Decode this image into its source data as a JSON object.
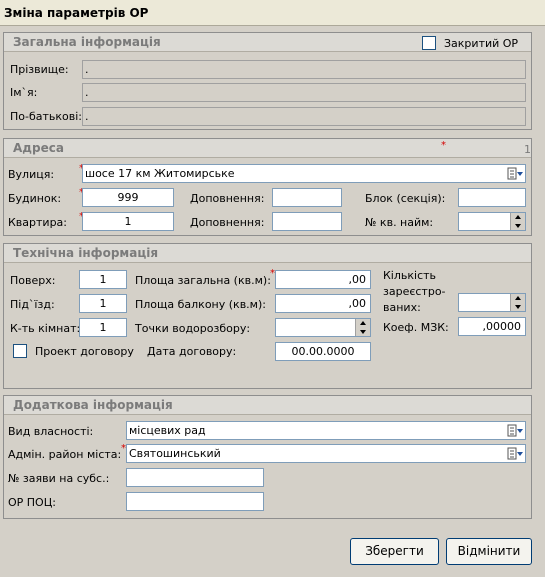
{
  "window": {
    "title": "Зміна параметрів ОР"
  },
  "general": {
    "header": "Загальна інформація",
    "closed_label": "Закритий ОР",
    "surname_label": "Прізвище:",
    "surname_value": ".",
    "name_label": "Ім`я:",
    "name_value": ".",
    "patronymic_label": "По-батькові:",
    "patronymic_value": "."
  },
  "address": {
    "header": "Адреса",
    "page_number": "1",
    "required_mark": "*",
    "street_label": "Вулиця:",
    "street_value": "шосе 17 км Житомирське",
    "building_label": "Будинок:",
    "building_value": "999",
    "building_add_label": "Доповнення:",
    "building_add_value": "",
    "block_label": "Блок (секція):",
    "block_value": "",
    "apartment_label": "Квартира:",
    "apartment_value": "1",
    "apartment_add_label": "Доповнення:",
    "apartment_add_value": "",
    "hire_no_label": "№ кв. найм:",
    "hire_no_value": ""
  },
  "technical": {
    "header": "Технічна інформація",
    "floor_label": "Поверх:",
    "floor_value": "1",
    "entrance_label": "Під`їзд:",
    "entrance_value": "1",
    "rooms_label": "К-ть кімнат:",
    "rooms_value": "1",
    "total_area_label": "Площа загальна (кв.м):",
    "total_area_value": ",00",
    "balcony_area_label": "Площа балкону (кв.м):",
    "balcony_area_value": ",00",
    "water_points_label": "Точки водорозбору:",
    "water_points_value": "",
    "registered_label_1": "Кількість",
    "registered_label_2": "зареєстро-",
    "registered_label_3": "ваних:",
    "registered_value": "",
    "coef_label": "Коеф. МЗК:",
    "coef_value": ",00000",
    "draft_contract_label": "Проект договору",
    "contract_date_label": "Дата договору:",
    "contract_date_value": "00.00.0000"
  },
  "additional": {
    "header": "Додаткова інформація",
    "ownership_label": "Вид власності:",
    "ownership_value": "місцевих рад",
    "district_label": "Адмін. район міста:",
    "district_value": "Святошинський",
    "subsidy_label": "№ заяви на субс.:",
    "subsidy_value": "",
    "poc_label": "ОР ПОЦ:",
    "poc_value": ""
  },
  "buttons": {
    "save": "Зберегти",
    "cancel": "Відмінити"
  },
  "icons": {
    "dropdown": "dropdown-list-icon",
    "spinner": "spinner-icon",
    "checkbox": "checkbox-icon"
  }
}
